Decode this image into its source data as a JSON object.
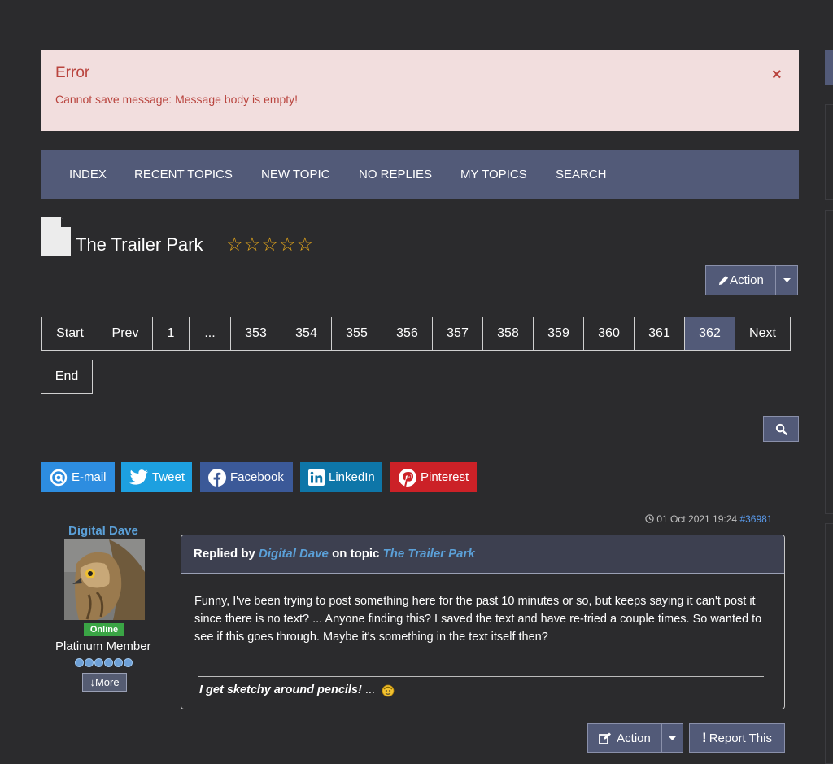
{
  "alert": {
    "title": "Error",
    "message": "Cannot save message: Message body is empty!",
    "close": "×"
  },
  "nav": {
    "items": [
      "INDEX",
      "RECENT TOPICS",
      "NEW TOPIC",
      "NO REPLIES",
      "MY TOPICS",
      "SEARCH"
    ]
  },
  "topic": {
    "title": "The Trailer Park",
    "stars": "☆☆☆☆☆"
  },
  "action_button": {
    "label": "Action"
  },
  "pagination": {
    "items": [
      "Start",
      "Prev",
      "1",
      "...",
      "353",
      "354",
      "355",
      "356",
      "357",
      "358",
      "359",
      "360",
      "361",
      "362",
      "Next"
    ],
    "active": "362",
    "end": "End"
  },
  "share": {
    "email": "E-mail",
    "tweet": "Tweet",
    "facebook": "Facebook",
    "linkedin": "LinkedIn",
    "pinterest": "Pinterest"
  },
  "post": {
    "author": "Digital Dave",
    "status": "Online",
    "rank": "Platinum Member",
    "more": "More",
    "date": "01 Oct 2021 19:24",
    "post_id": "#36981",
    "replied_by": "Replied by",
    "on_topic": "on topic",
    "topic": "The Trailer Park",
    "body": "Funny, I've been trying to post something here for the past 10 minutes or so, but keeps saying it can't post it since there is no text? ... Anyone finding this? I saved the text and have re-tried a couple times. So wanted to see if this goes through. Maybe it's something in the text itself then?",
    "signature": "I get sketchy around pencils!",
    "signature_suffix": "..."
  },
  "post_actions": {
    "action": "Action",
    "report": "Report This"
  },
  "colors": {
    "background": "#2b2b2d",
    "nav": "#525a78",
    "error_bg": "#f2dede",
    "error_text": "#b9443e",
    "link": "#5ba0d8",
    "star": "#e8a91b",
    "online": "#3aa545"
  }
}
